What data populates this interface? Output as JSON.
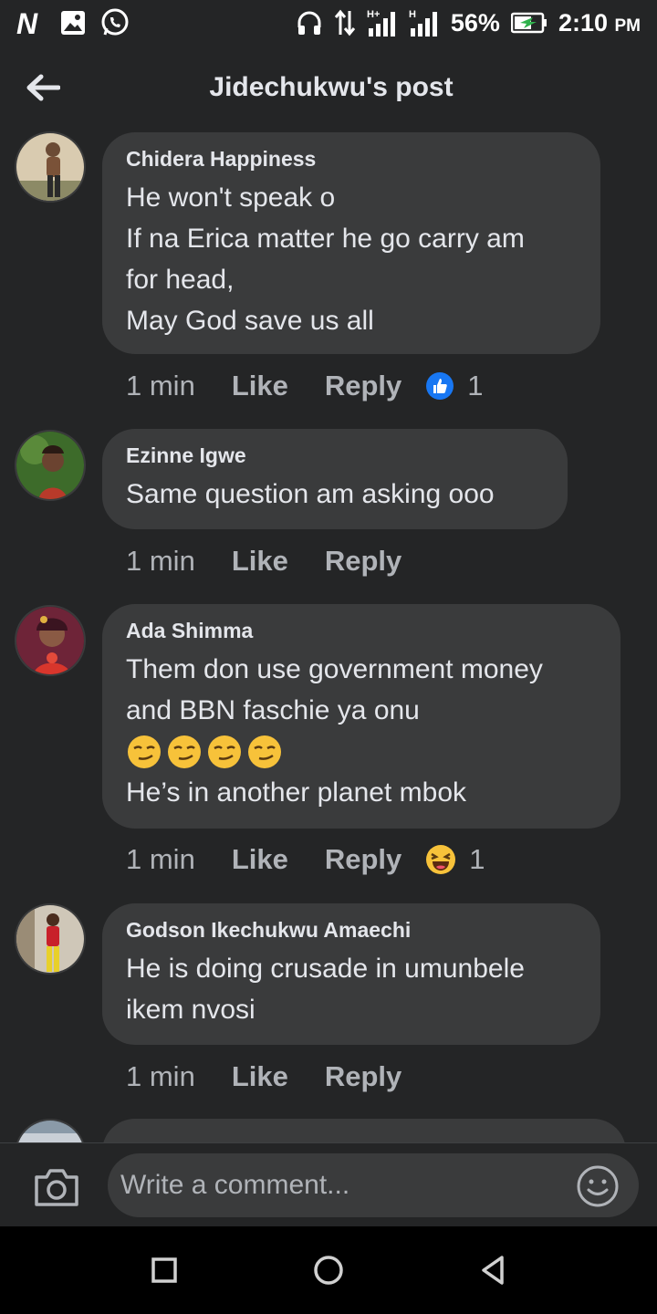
{
  "status_bar": {
    "battery": "56%",
    "time": "2:10",
    "ampm": "PM",
    "network_labels": [
      "H+",
      "H"
    ]
  },
  "header": {
    "title": "Jidechukwu's post"
  },
  "comments": [
    {
      "author": "Chidera Happiness",
      "text": "He won't speak o\nIf na Erica matter he go carry am\nfor head,\nMay God save us all",
      "time": "1 min",
      "like": "Like",
      "reply": "Reply",
      "reaction": {
        "type": "like-icon",
        "count": "1"
      }
    },
    {
      "author": "Ezinne Igwe",
      "text": "Same question am asking ooo",
      "time": "1 min",
      "like": "Like",
      "reply": "Reply"
    },
    {
      "author": "Ada Shimma",
      "text_before": "Them don use government money\nand BBN faschie ya onu",
      "emojis": [
        "smirk-emoji",
        "smirk-emoji",
        "smirk-emoji",
        "smirk-emoji"
      ],
      "text_after": "He’s in another planet mbok",
      "time": "1 min",
      "like": "Like",
      "reply": "Reply",
      "reaction": {
        "type": "haha-icon",
        "count": "1"
      }
    },
    {
      "author": "Godson Ikechukwu Amaechi",
      "text": "He is doing crusade in umunbele\nikem nvosi",
      "time": "1 min",
      "like": "Like",
      "reply": "Reply"
    }
  ],
  "composer": {
    "placeholder": "Write a comment..."
  },
  "colors": {
    "background": "#242526",
    "bubble": "#3a3b3c",
    "text": "#e4e6eb",
    "secondary": "#b0b3b8",
    "like_blue": "#1877f2"
  }
}
